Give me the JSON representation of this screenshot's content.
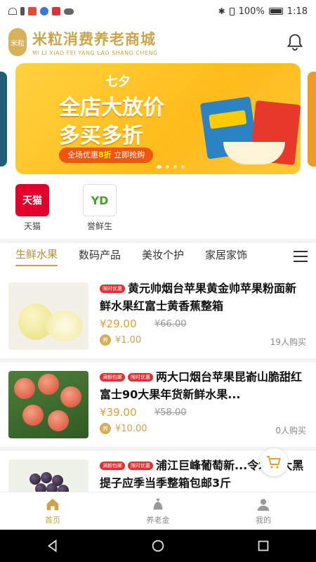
{
  "status_bar": {
    "battery": "100%",
    "time": "1:18"
  },
  "header": {
    "logo_text": "米粒",
    "brand_name": "米粒消费养老商城",
    "brand_sub": "MI LI XIAO FEI YANG LAO SHANG CHENG"
  },
  "banner": {
    "line1": "七夕",
    "line2": "全店大放价",
    "line3": "多买多折",
    "pill_prefix": "全场优惠",
    "pill_highlight": "8折",
    "pill_suffix": " 立即抢购",
    "page_count": 4,
    "active_page": 1
  },
  "shortcuts": [
    {
      "icon_text": "天猫",
      "label": "天猫"
    },
    {
      "icon_text": "YD",
      "label": "誉鲜生"
    }
  ],
  "tabs": [
    {
      "label": "生鲜水果",
      "active": true
    },
    {
      "label": "数码产品",
      "active": false
    },
    {
      "label": "美妆个护",
      "active": false
    },
    {
      "label": "家居家饰",
      "active": false
    }
  ],
  "products": [
    {
      "tags": [
        "限时优惠"
      ],
      "title": "黄元帅烟台苹果黄金帅苹果粉面新鲜水果红富士黄香蕉整箱",
      "price": "¥29.00",
      "original_price": "¥66.00",
      "coin_label": "养",
      "reward": "¥1.00",
      "sold": "19人购买"
    },
    {
      "tags": [
        "满额包邮",
        "限时优惠"
      ],
      "title": "两大口烟台苹果昆嵛山脆甜红富士90大果年货新鲜水果...",
      "price": "¥39.00",
      "original_price": "¥58.00",
      "coin_label": "养",
      "reward": "¥10.00",
      "sold": "0人购买"
    },
    {
      "tags": [
        "满额包邮",
        "限时优惠"
      ],
      "title": "浦江巨峰葡萄新...令水果大黑提子应季当季整箱包邮3斤",
      "price": "",
      "original_price": "",
      "coin_label": "",
      "reward": "",
      "sold": ""
    }
  ],
  "bottom_nav": [
    {
      "label": "首页",
      "icon": "home-icon",
      "active": true
    },
    {
      "label": "养老金",
      "icon": "money-bag-icon",
      "active": false
    },
    {
      "label": "我的",
      "icon": "user-icon",
      "active": false
    }
  ],
  "colors": {
    "brand_gold": "#c9a54c",
    "price": "#e0a030",
    "banner_yellow": "#ffc72a",
    "tag_red": "#e62d2d"
  }
}
